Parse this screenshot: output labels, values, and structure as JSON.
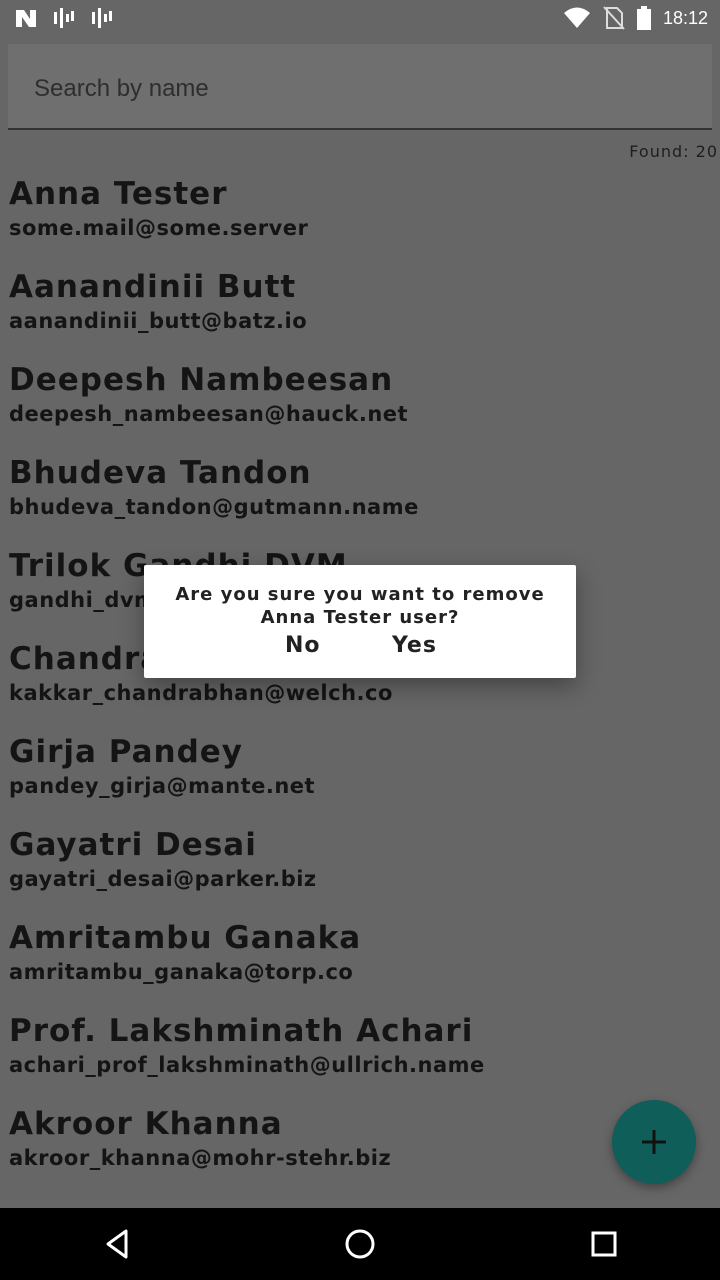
{
  "status_bar": {
    "time": "18:12",
    "icons": [
      "n-logo-icon",
      "signal-bars-icon",
      "signal-bars-icon",
      "wifi-icon",
      "no-sim-icon",
      "battery-icon"
    ]
  },
  "search": {
    "placeholder": "Search by name",
    "value": ""
  },
  "found_label": "Found: 20",
  "users": [
    {
      "name": "Anna Tester",
      "email": "some.mail@some.server"
    },
    {
      "name": "Aanandinii Butt",
      "email": "aanandinii_butt@batz.io"
    },
    {
      "name": "Deepesh Nambeesan",
      "email": "deepesh_nambeesan@hauck.net"
    },
    {
      "name": "Bhudeva Tandon",
      "email": "bhudeva_tandon@gutmann.name"
    },
    {
      "name": "Trilok Gandhi DVM",
      "email": "gandhi_dvm"
    },
    {
      "name": "Chandrab",
      "email": "kakkar_chandrabhan@welch.co"
    },
    {
      "name": "Girja Pandey",
      "email": "pandey_girja@mante.net"
    },
    {
      "name": "Gayatri Desai",
      "email": "gayatri_desai@parker.biz"
    },
    {
      "name": "Amritambu Ganaka",
      "email": "amritambu_ganaka@torp.co"
    },
    {
      "name": "Prof. Lakshminath Achari",
      "email": "achari_prof_lakshminath@ullrich.name"
    },
    {
      "name": "Akroor Khanna",
      "email": "akroor_khanna@mohr-stehr.biz"
    },
    {
      "name": "",
      "email": ""
    }
  ],
  "dialog": {
    "message": "Are you sure you want to remove Anna Tester user?",
    "no_label": "No",
    "yes_label": "Yes"
  },
  "fab": {
    "icon": "plus-icon",
    "color": "#0f5e59"
  },
  "nav_bar": {
    "icons": [
      "back-icon",
      "home-icon",
      "recents-icon"
    ]
  }
}
